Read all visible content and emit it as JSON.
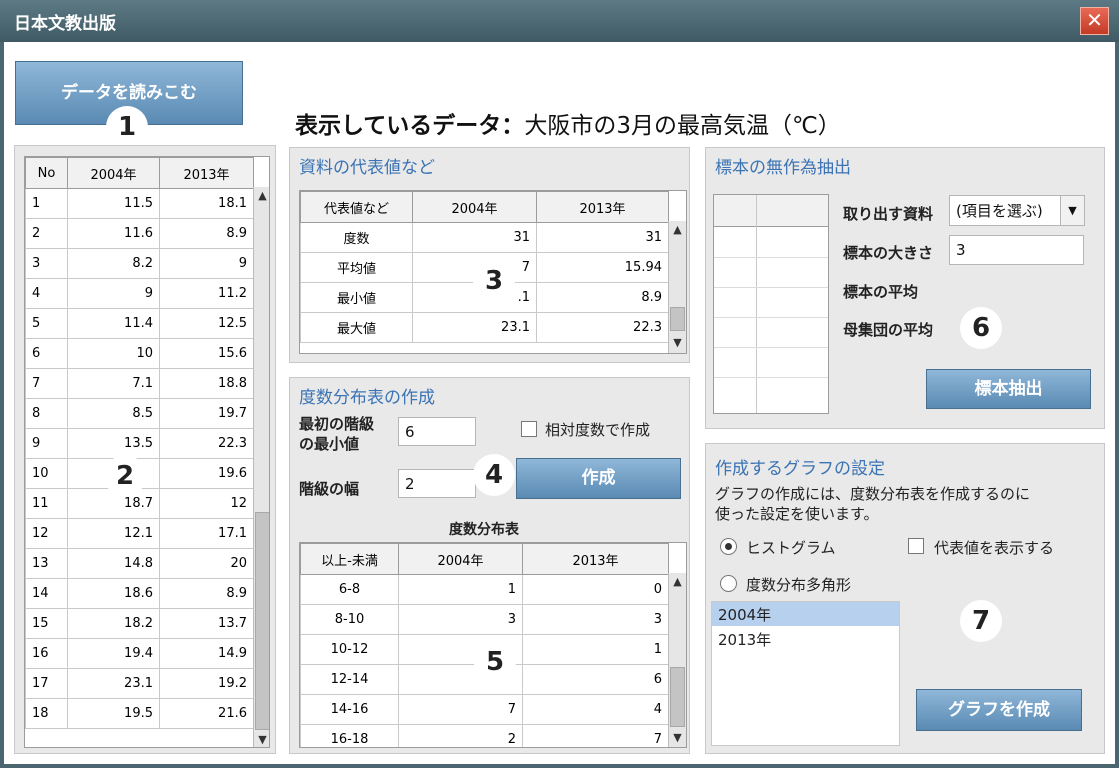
{
  "window": {
    "title": "日本文教出版",
    "close": "✕"
  },
  "load_button": "データを読みこむ",
  "data_heading": {
    "label": "表示しているデータ：",
    "value": "大阪市の3月の最高気温（℃）"
  },
  "markers": [
    "1",
    "2",
    "3",
    "4",
    "5",
    "6",
    "7"
  ],
  "data_table": {
    "headers": [
      "No",
      "2004年",
      "2013年"
    ],
    "rows": [
      [
        "1",
        "11.5",
        "18.1"
      ],
      [
        "2",
        "11.6",
        "8.9"
      ],
      [
        "3",
        "8.2",
        "9"
      ],
      [
        "4",
        "9",
        "11.2"
      ],
      [
        "5",
        "11.4",
        "12.5"
      ],
      [
        "6",
        "10",
        "15.6"
      ],
      [
        "7",
        "7.1",
        "18.8"
      ],
      [
        "8",
        "8.5",
        "19.7"
      ],
      [
        "9",
        "13.5",
        "22.3"
      ],
      [
        "10",
        "",
        "19.6"
      ],
      [
        "11",
        "18.7",
        "12"
      ],
      [
        "12",
        "12.1",
        "17.1"
      ],
      [
        "13",
        "14.8",
        "20"
      ],
      [
        "14",
        "18.6",
        "8.9"
      ],
      [
        "15",
        "18.2",
        "13.7"
      ],
      [
        "16",
        "19.4",
        "14.9"
      ],
      [
        "17",
        "23.1",
        "19.2"
      ],
      [
        "18",
        "19.5",
        "21.6"
      ]
    ]
  },
  "stats_panel": {
    "title": "資料の代表値など",
    "headers": [
      "代表値など",
      "2004年",
      "2013年"
    ],
    "rows": [
      [
        "度数",
        "31",
        "31"
      ],
      [
        "平均値",
        "7",
        "15.94"
      ],
      [
        "最小値",
        ".1",
        "8.9"
      ],
      [
        "最大値",
        "23.1",
        "22.3"
      ]
    ]
  },
  "freq_panel": {
    "title": "度数分布表の作成",
    "first_class_label_1": "最初の階級",
    "first_class_label_2": "の最小値",
    "first_class_value": "6",
    "width_label": "階級の幅",
    "width_value": "2",
    "relative_label": "相対度数で作成",
    "create_button": "作成",
    "table_title": "度数分布表",
    "headers": [
      "以上-未満",
      "2004年",
      "2013年"
    ],
    "rows": [
      [
        "6-8",
        "1",
        "0"
      ],
      [
        "8-10",
        "3",
        "3"
      ],
      [
        "10-12",
        "",
        "1"
      ],
      [
        "12-14",
        "",
        "6"
      ],
      [
        "14-16",
        "7",
        "4"
      ],
      [
        "16-18",
        "2",
        "7"
      ]
    ]
  },
  "sample_panel": {
    "title": "標本の無作為抽出",
    "source_label": "取り出す資料",
    "source_select": "(項目を選ぶ)",
    "size_label": "標本の大きさ",
    "size_value": "3",
    "sample_mean_label": "標本の平均",
    "population_mean_label": "母集団の平均",
    "extract_button": "標本抽出"
  },
  "graph_panel": {
    "title": "作成するグラフの設定",
    "note_1": "グラフの作成には、度数分布表を作成するのに",
    "note_2": "使った設定を使います。",
    "histogram_label": "ヒストグラム",
    "show_rep_label": "代表値を表示する",
    "polygon_label": "度数分布多角形",
    "series": [
      "2004年",
      "2013年"
    ],
    "create_button": "グラフを作成"
  },
  "colors": {
    "titlebar": "#4b6670",
    "accent": "#3b73b4",
    "button": "#6e9cc4",
    "selected": "#b7d0ee"
  }
}
